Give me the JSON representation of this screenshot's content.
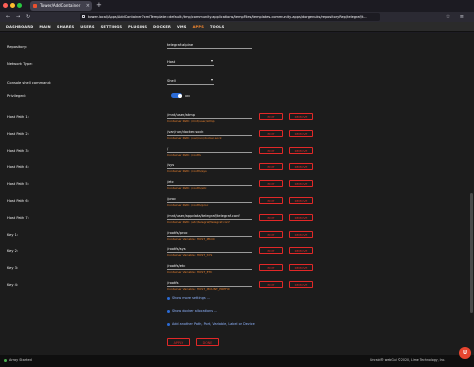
{
  "browser": {
    "tab_title": "Tower/AddContainer",
    "url": "tower.local/Apps/AddContainer?xmlTemplate=default:/tmp/community.applications/tempFiles/templates-community-apps/dorgenuks/repositoryRep/telegraf/t..."
  },
  "nav": {
    "items": [
      "DASHBOARD",
      "MAIN",
      "SHARES",
      "USERS",
      "SETTINGS",
      "PLUGINS",
      "DOCKER",
      "VMS",
      "APPS",
      "TOOLS"
    ],
    "active": "APPS"
  },
  "form": {
    "repository": {
      "label": "Repository:",
      "value": "telegraf:alpine"
    },
    "network_type": {
      "label": "Network Type:",
      "value": "Host"
    },
    "console_shell": {
      "label": "Console shell command:",
      "value": "Shell"
    },
    "privileged": {
      "label": "Privileged:",
      "state": "ON"
    },
    "mappings": [
      {
        "label": "Host Path 1:",
        "value": "/mnt/user/atmp",
        "hint": "Container Path: /mnt/user/atmp"
      },
      {
        "label": "Host Path 2:",
        "value": "/var/run/docker.sock",
        "hint": "Container Path: /var/run/docker.sock"
      },
      {
        "label": "Host Path 3:",
        "value": "/",
        "hint": "Container Path: /rootfs"
      },
      {
        "label": "Host Path 4:",
        "value": "/sys",
        "hint": "Container Path: /rootfs/sys"
      },
      {
        "label": "Host Path 5:",
        "value": "/etc",
        "hint": "Container Path: /rootfs/etc"
      },
      {
        "label": "Host Path 6:",
        "value": "/proc",
        "hint": "Container Path: /rootfs/proc"
      },
      {
        "label": "Host Path 7:",
        "value": "/mnt/user/appdata/telegraf/telegraf.conf",
        "hint": "Container Path: /etc/telegraf/telegraf.conf"
      },
      {
        "label": "Key 1:",
        "value": "/rootfs/proc",
        "hint": "Container Variable: HOST_PROC"
      },
      {
        "label": "Key 2:",
        "value": "/rootfs/sys",
        "hint": "Container Variable: HOST_SYS"
      },
      {
        "label": "Key 3:",
        "value": "/rootfs/etc",
        "hint": "Container Variable: HOST_ETC"
      },
      {
        "label": "Key 4:",
        "value": "/rootfs",
        "hint": "Container Variable: HOST_MOUNT_PREFIX"
      }
    ],
    "edit_label": "EDIT",
    "remove_label": "REMOVE",
    "show_more": "Show more settings ...",
    "show_docker": "Show docker allocations ...",
    "add_another": "Add another Path, Port, Variable, Label or Device",
    "apply_label": "APPLY",
    "done_label": "DONE"
  },
  "status": {
    "left": "Array Started",
    "right": "Unraid® webGui ©2020, Lime Technology, Inc."
  },
  "colors": {
    "accent": "#e22828",
    "orange": "#ff8c2f",
    "link": "#8fb4ff"
  }
}
